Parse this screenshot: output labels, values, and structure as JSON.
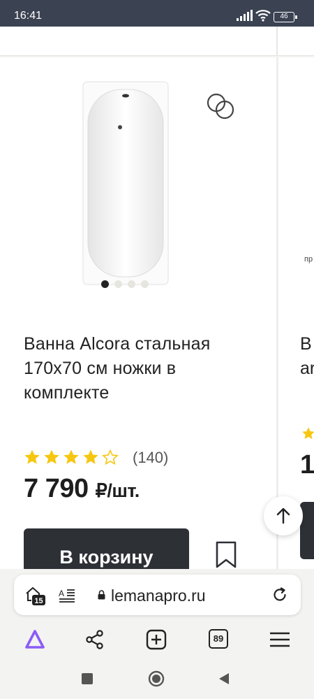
{
  "status": {
    "time": "16:41",
    "battery": "46"
  },
  "product": {
    "title": "Ванна Alcora стальная 170х70 см ножки в комплекте",
    "rating": 4,
    "rating_max": 5,
    "reviews": "(140)",
    "price": "7 790",
    "price_unit": "₽/шт.",
    "cart_button": "В корзину",
    "gallery_count": 4,
    "gallery_active": 1
  },
  "next_card": {
    "label_fragment": "пр",
    "title_line1": "В",
    "title_line2": "ar",
    "price_fragment": "1"
  },
  "browser": {
    "url": "lemanapro.ru",
    "tabs_badge": "15",
    "open_tabs": "89"
  },
  "icons": [
    "compare-icon",
    "bookmark-icon",
    "scroll-up-icon",
    "alice-icon",
    "share-icon",
    "new-tab-icon",
    "menu-icon",
    "reload-icon",
    "lock-icon",
    "reader-icon"
  ],
  "colors": {
    "star": "#f6c711",
    "button": "#2d3035",
    "alice": "#8b5cf6",
    "statusbar": "#3b4252"
  }
}
